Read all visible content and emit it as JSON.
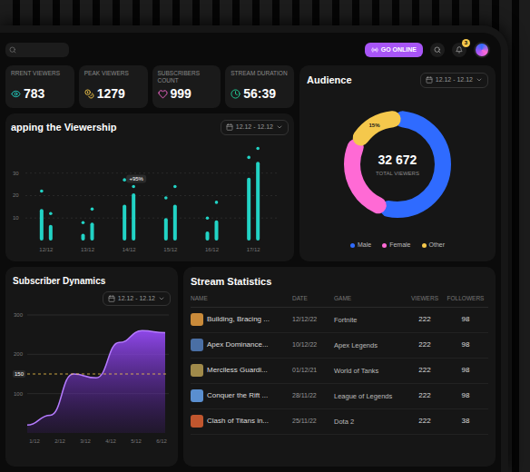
{
  "header": {
    "button": "GO ONLINE",
    "notifications": "3",
    "date_range": "12.12 - 12.12"
  },
  "stats": [
    {
      "label": "RRENT VIEWERS",
      "value": "783",
      "kind": "viewers",
      "color": "#22d3c5"
    },
    {
      "label": "PEAK VIEWERS",
      "value": "1279",
      "kind": "peak",
      "color": "#f5c84c"
    },
    {
      "label": "SUBSCRIBERS COUNT",
      "value": "999",
      "kind": "subscribers",
      "color": "#ff6ad5"
    },
    {
      "label": "STREAM DURATION",
      "value": "56:39",
      "kind": "duration",
      "color": "#22d39a"
    }
  ],
  "viewership": {
    "title": "apping the Viewership",
    "date_range": "12.12 - 12.12",
    "y_ticks": [
      "30",
      "20",
      "10"
    ],
    "x_labels": [
      "12/12",
      "13/12",
      "14/12",
      "15/12",
      "16/12",
      "17/12"
    ],
    "tooltip": "+95%",
    "tooltip_index": 5,
    "viewers": [
      14,
      7,
      3,
      8,
      16,
      21,
      10,
      16,
      4,
      9,
      28,
      35
    ],
    "peaks": [
      22,
      12,
      8,
      14,
      27,
      24,
      19,
      24,
      10,
      17,
      37,
      41
    ]
  },
  "audience": {
    "title": "Audience",
    "total": "32 672",
    "total_label": "TOTAL VIEWERS",
    "segments": [
      {
        "label": "Male",
        "level": 0.55,
        "color": "#2f6bff",
        "badge": ""
      },
      {
        "label": "Female",
        "level": 0.28,
        "color": "#ff6ad5",
        "badge": ""
      },
      {
        "label": "Other",
        "level": 0.17,
        "color": "#f5c84c",
        "badge": "15%"
      }
    ]
  },
  "subscribers": {
    "title": "Subscriber Dynamics",
    "date_range": "12.12 - 12.12",
    "y_ticks": [
      "300",
      "200",
      "100"
    ],
    "x_labels": [
      "1/12",
      "2/12",
      "3/12",
      "4/12",
      "5/12",
      "6/12"
    ],
    "threshold": 150,
    "threshold_label": "150",
    "values": [
      20,
      45,
      150,
      140,
      230,
      260,
      255
    ]
  },
  "streams": {
    "title": "Stream Statistics",
    "columns": [
      "NAME",
      "DATE",
      "GAME",
      "VIEWERS",
      "FOLLOWERS"
    ],
    "rows": [
      {
        "name": "Building, Bracing ...",
        "date": "12/12/22",
        "game": "Fortnite",
        "viewers": "222",
        "followers": "98",
        "color": "#c98a3a"
      },
      {
        "name": "Apex Dominance...",
        "date": "10/12/22",
        "game": "Apex Legends",
        "viewers": "222",
        "followers": "98",
        "color": "#4a6fa5"
      },
      {
        "name": "Merciless Guardi...",
        "date": "01/12/21",
        "game": "World of Tanks",
        "viewers": "222",
        "followers": "98",
        "color": "#a08a4a"
      },
      {
        "name": "Conquer the Rift ...",
        "date": "28/11/22",
        "game": "League of Legends",
        "viewers": "222",
        "followers": "98",
        "color": "#5a8fd0"
      },
      {
        "name": "Clash of Titans in...",
        "date": "25/11/22",
        "game": "Dota 2",
        "viewers": "222",
        "followers": "38",
        "color": "#c0562e"
      }
    ]
  }
}
